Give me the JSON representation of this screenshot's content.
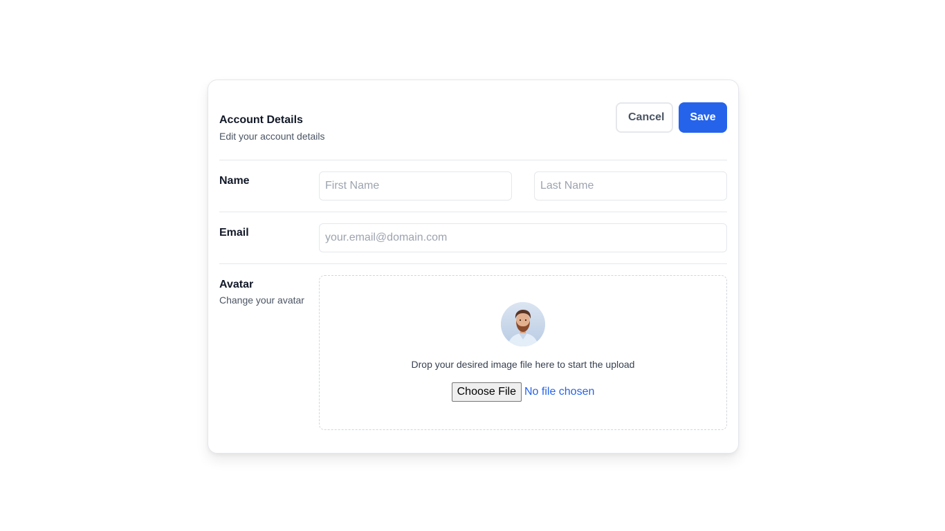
{
  "header": {
    "title": "Account Details",
    "subtitle": "Edit your account details",
    "cancel_label": "Cancel",
    "save_label": "Save"
  },
  "name_row": {
    "label": "Name",
    "first_placeholder": "First Name",
    "last_placeholder": "Last Name"
  },
  "email_row": {
    "label": "Email",
    "placeholder": "your.email@domain.com"
  },
  "avatar_row": {
    "label": "Avatar",
    "sublabel": "Change your avatar",
    "drop_text": "Drop your desired image file here to start the upload",
    "choose_label": "Choose File",
    "file_status": "No file chosen"
  },
  "colors": {
    "accent": "#2563eb",
    "border": "#e5e7eb"
  }
}
